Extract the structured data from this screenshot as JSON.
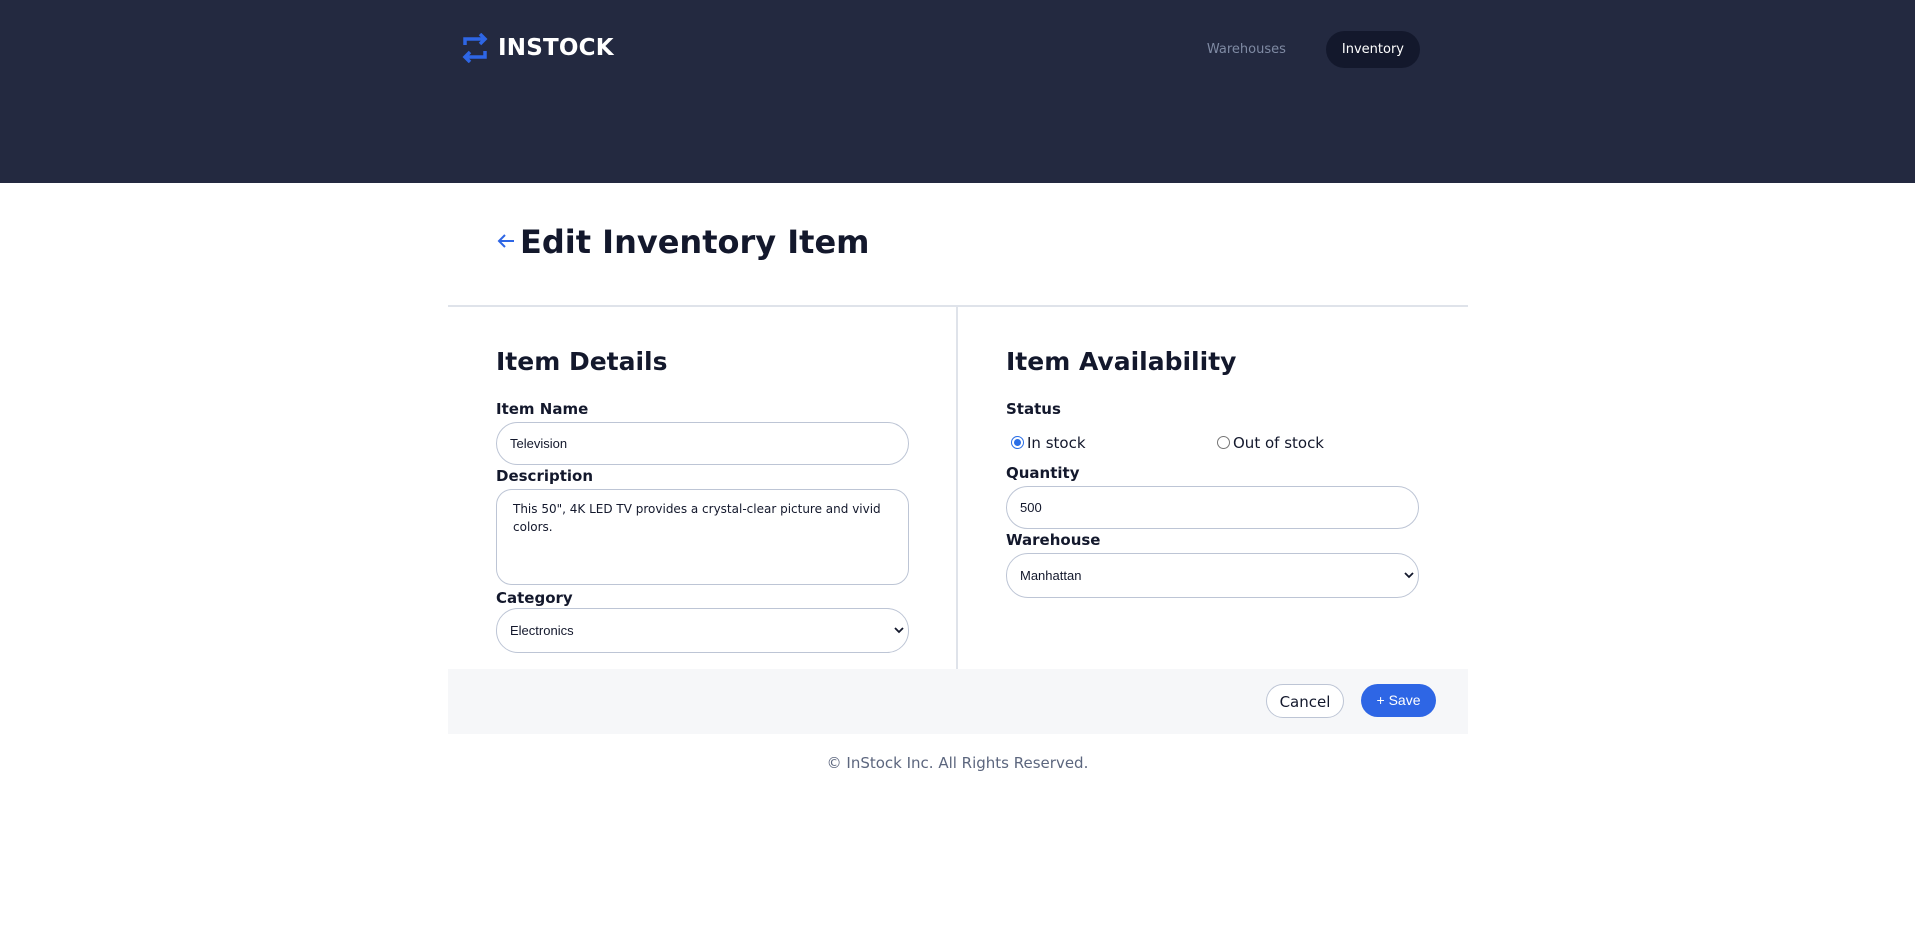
{
  "brand": {
    "name": "INSTOCK",
    "accent": "#2e66e5"
  },
  "nav": {
    "items": [
      {
        "label": "Warehouses",
        "active": false
      },
      {
        "label": "Inventory",
        "active": true
      }
    ]
  },
  "page": {
    "title": "Edit Inventory Item",
    "back_icon": "arrow-left-icon"
  },
  "item_details": {
    "section_title": "Item Details",
    "name_label": "Item Name",
    "name_value": "Television",
    "description_label": "Description",
    "description_value": "This 50\", 4K LED TV provides a crystal-clear picture and vivid colors.",
    "category_label": "Category",
    "category_value": "Electronics"
  },
  "availability": {
    "section_title": "Item Availability",
    "status_label": "Status",
    "status_options": [
      {
        "label": "In stock",
        "checked": true
      },
      {
        "label": "Out of stock",
        "checked": false
      }
    ],
    "quantity_label": "Quantity",
    "quantity_value": "500",
    "warehouse_label": "Warehouse",
    "warehouse_value": "Manhattan"
  },
  "actions": {
    "cancel_label": "Cancel",
    "save_label": "+ Save"
  },
  "footer": {
    "copyright": "© InStock Inc. All Rights Reserved."
  }
}
